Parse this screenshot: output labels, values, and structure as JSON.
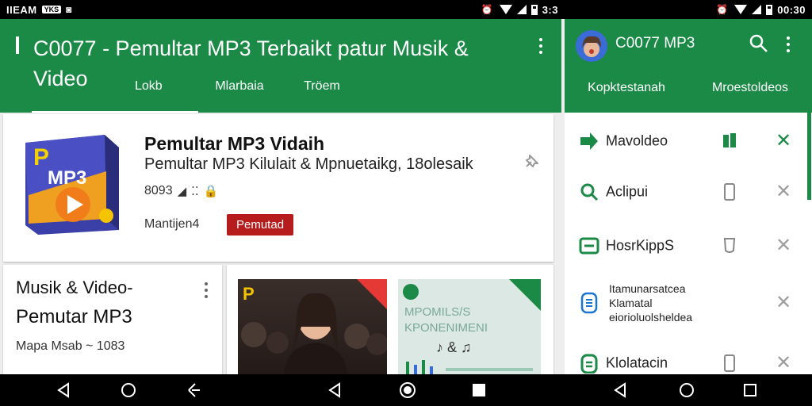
{
  "status_left": {
    "carrier": "IIEAM",
    "badge": "YKS",
    "time": "3:3"
  },
  "status_right": {
    "time": "00:30"
  },
  "left_pane": {
    "title": "C0077 - Pemultar MP3 Terbaikt patur Musik & Video",
    "tabs": [
      "Lokb",
      "Mlarbaia",
      "Tröem"
    ],
    "app_card": {
      "name": "Pemultar MP3 Vidaih",
      "subtitle": "Pemultar MP3 Kilulait  &  Mpnuetaikg, 18olesaik",
      "meta": "8093",
      "developer": "Mantijen4",
      "install_label": "Pemutad",
      "icon_letter": "P",
      "icon_text": "MP3"
    },
    "card_bl": {
      "title": "Musik & Video-",
      "title2": "Pemutar MP3",
      "meta": "Mapa Msab ~ 1083"
    },
    "card_br": {
      "thumb1_letter": "P",
      "thumb2_text1": "MPOMILS/S",
      "thumb2_text2": "KPONENIMENI"
    }
  },
  "right_pane": {
    "title": "C0077 MP3",
    "tabs": [
      "Kopktestanah",
      "Mroestoldeos"
    ],
    "items": [
      {
        "label": "Mavoldeo",
        "icon": "arrow-forward-icon"
      },
      {
        "label": "Aclipui",
        "icon": "search-icon"
      },
      {
        "label": "HosrKippS",
        "icon": "card-icon"
      },
      {
        "label": "Itamunarsatcea Klamatal eiorioluolsheldea",
        "icon": "phone-icon"
      },
      {
        "label": "Klolatacin",
        "icon": "list-icon"
      }
    ]
  },
  "colors": {
    "brand_green": "#1a8a46",
    "install_red": "#b71c1c"
  }
}
